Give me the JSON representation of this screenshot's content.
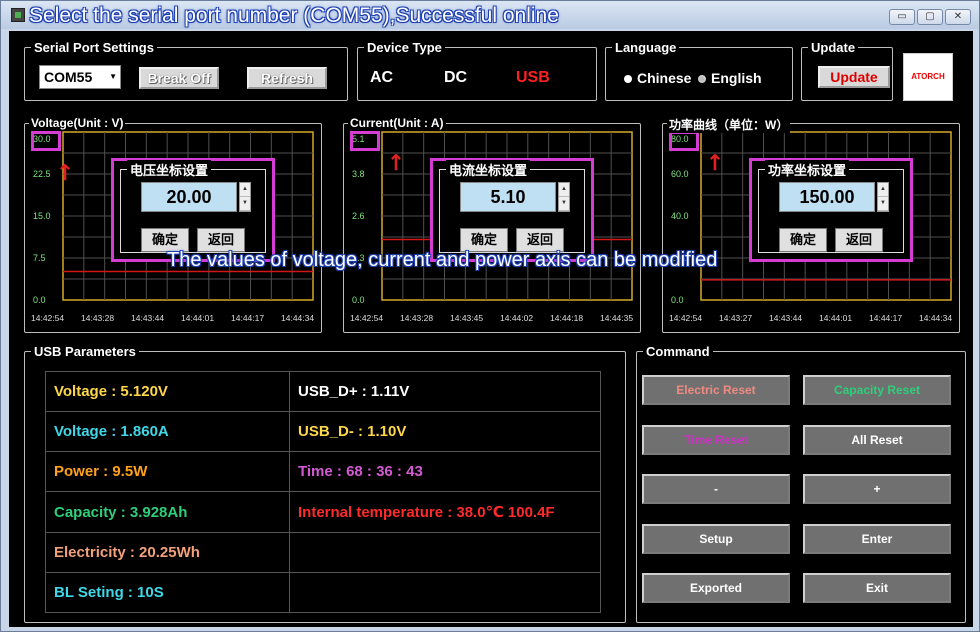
{
  "window": {
    "title": "Select the serial port number (COM55),Successful online",
    "buttons": {
      "minimize": "▭",
      "maximize": "▢",
      "close": "✕"
    }
  },
  "serial": {
    "group_title": "Serial Port Settings",
    "port_value": "COM55",
    "break_label": "Break Off",
    "refresh_label": "Refresh"
  },
  "device": {
    "group_title": "Device Type",
    "ac": "AC",
    "dc": "DC",
    "usb": "USB",
    "selected_color": "#ff2020"
  },
  "language": {
    "group_title": "Language",
    "chinese": "Chinese",
    "english": "English"
  },
  "update": {
    "group_title": "Update",
    "button_label": "Update",
    "logo_text": "ATORCH"
  },
  "charts": {
    "voltage": {
      "title": "Voltage(Unit : V)",
      "y_ticks": [
        "30.0",
        "22.5",
        "15.0",
        "7.5",
        "0.0"
      ],
      "x_ticks": [
        "14:42:54",
        "14:43:28",
        "14:43:44",
        "14:44:01",
        "14:44:17",
        "14:44:34"
      ],
      "dialog_title": "电压坐标设置",
      "dialog_value": "20.00",
      "ok_label": "确定",
      "back_label": "返回",
      "line_value_fraction": 0.17
    },
    "current": {
      "title": "Current(Unit : A)",
      "y_ticks": [
        "5.1",
        "3.8",
        "2.6",
        "1.3",
        "0.0"
      ],
      "x_ticks": [
        "14:42:54",
        "14:43:28",
        "14:43:45",
        "14:44:02",
        "14:44:18",
        "14:44:35"
      ],
      "dialog_title": "电流坐标设置",
      "dialog_value": "5.10",
      "ok_label": "确定",
      "back_label": "返回",
      "line_value_fraction": 0.36
    },
    "power": {
      "title": "功率曲线（单位：W）",
      "y_ticks": [
        "80.0",
        "60.0",
        "40.0",
        "20.0",
        "0.0"
      ],
      "x_ticks": [
        "14:42:54",
        "14:43:27",
        "14:43:44",
        "14:44:01",
        "14:44:17",
        "14:44:34"
      ],
      "dialog_title": "功率坐标设置",
      "dialog_value": "150.00",
      "ok_label": "确定",
      "back_label": "返回",
      "line_value_fraction": 0.12
    }
  },
  "overlay_caption": "The values of voltage, current and power axis can be modified",
  "usb_params": {
    "group_title": "USB Parameters",
    "rows": [
      {
        "left": "Voltage : 5.120V",
        "left_color": "#ffd84a",
        "right": "USB_D+ : 1.11V",
        "right_color": "#ffffff"
      },
      {
        "left": "Voltage : 1.860A",
        "left_color": "#40d8e8",
        "right": "USB_D- : 1.10V",
        "right_color": "#ffd84a"
      },
      {
        "left": "Power : 9.5W",
        "left_color": "#ffa21c",
        "right": "Time : 68 : 36 : 43",
        "right_color": "#d45ad4"
      },
      {
        "left": "Capacity : 3.928Ah",
        "left_color": "#2ecf7a",
        "right": "Internal temperature : 38.0℃ 100.4F",
        "right_color": "#ff2a2a"
      },
      {
        "left": "Electricity : 20.25Wh",
        "left_color": "#f4a07a",
        "right": "",
        "right_color": "#ffffff"
      },
      {
        "left": "BL Seting : 10S",
        "left_color": "#40d8e8",
        "right": "",
        "right_color": "#ffffff"
      }
    ]
  },
  "command": {
    "group_title": "Command",
    "buttons": [
      {
        "label": "Electric Reset",
        "color": "#f08a80"
      },
      {
        "label": "Capacity Reset",
        "color": "#2ecf7a"
      },
      {
        "label": "Time Reset",
        "color": "#d030c8"
      },
      {
        "label": "All Reset",
        "color": "#ffffff"
      },
      {
        "label": "-",
        "color": "#ffffff"
      },
      {
        "label": "+",
        "color": "#ffffff"
      },
      {
        "label": "Setup",
        "color": "#ffffff"
      },
      {
        "label": "Enter",
        "color": "#ffffff"
      },
      {
        "label": "Exported",
        "color": "#ffffff"
      },
      {
        "label": "Exit",
        "color": "#ffffff"
      }
    ]
  },
  "colors": {
    "chart_grid": "#505050",
    "chart_frame": "#d6a92a",
    "chart_line": "#d01818",
    "tick_green": "#7fe27f",
    "tick_gray": "#dddddd",
    "highlight": "#d43cd4"
  }
}
